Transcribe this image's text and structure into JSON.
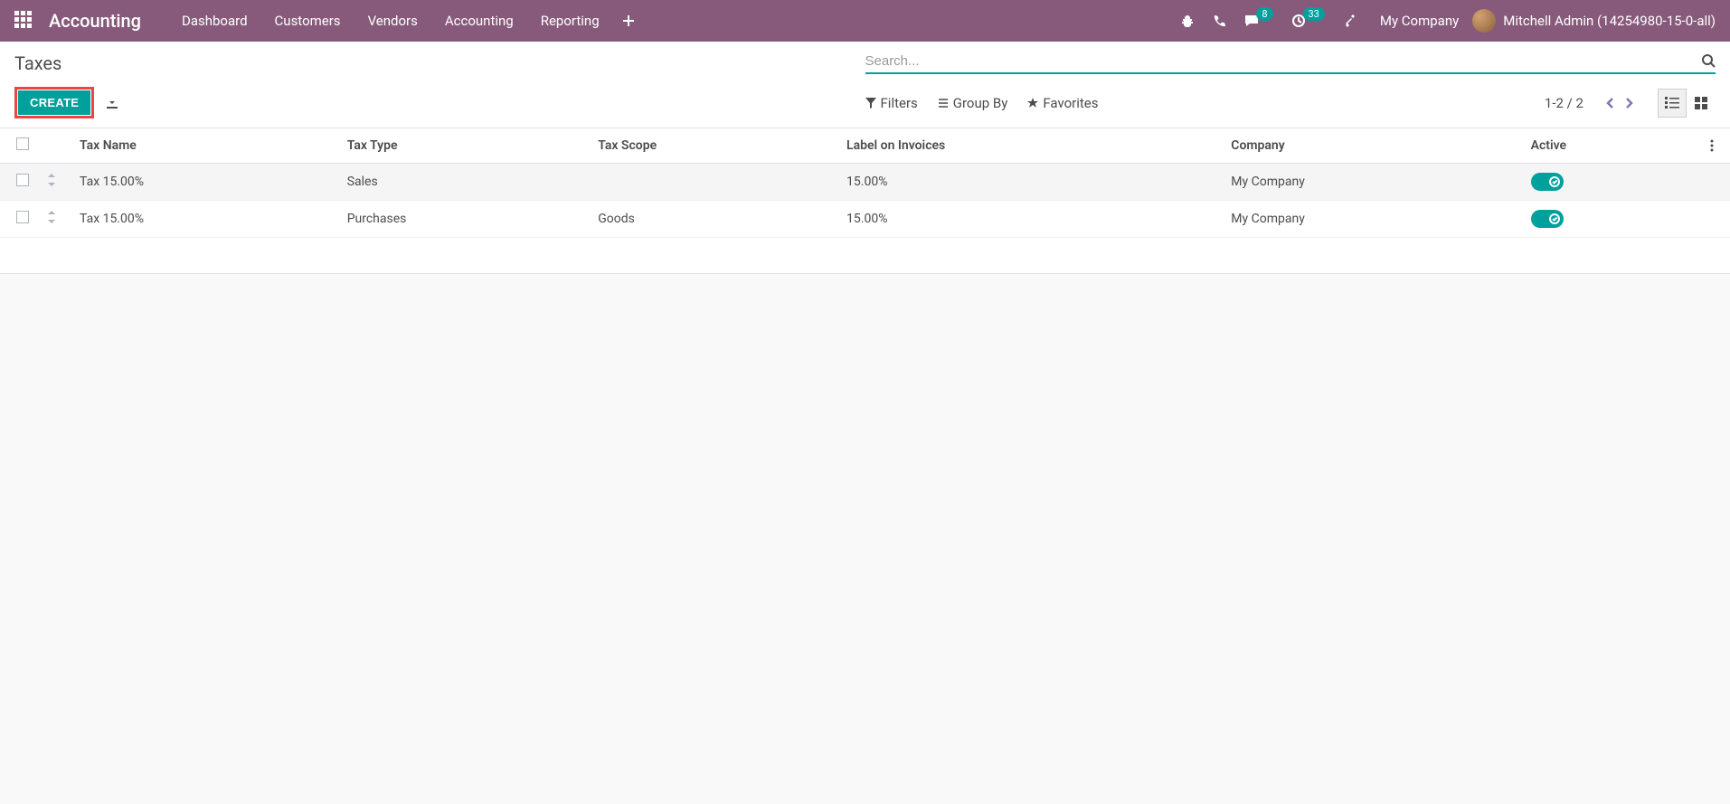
{
  "navbar": {
    "brand": "Accounting",
    "menu": [
      "Dashboard",
      "Customers",
      "Vendors",
      "Accounting",
      "Reporting"
    ],
    "messages_badge": "8",
    "activities_badge": "33",
    "company": "My Company",
    "user": "Mitchell Admin (14254980-15-0-all)"
  },
  "breadcrumb": "Taxes",
  "search": {
    "placeholder": "Search..."
  },
  "buttons": {
    "create": "CREATE"
  },
  "filters": {
    "filters_label": "Filters",
    "groupby_label": "Group By",
    "favorites_label": "Favorites"
  },
  "pager": {
    "text": "1-2 / 2"
  },
  "columns": {
    "name": "Tax Name",
    "type": "Tax Type",
    "scope": "Tax Scope",
    "label": "Label on Invoices",
    "company": "Company",
    "active": "Active"
  },
  "rows": [
    {
      "name": "Tax 15.00%",
      "type": "Sales",
      "scope": "",
      "label": "15.00%",
      "company": "My Company",
      "active": true
    },
    {
      "name": "Tax 15.00%",
      "type": "Purchases",
      "scope": "Goods",
      "label": "15.00%",
      "company": "My Company",
      "active": true
    }
  ]
}
